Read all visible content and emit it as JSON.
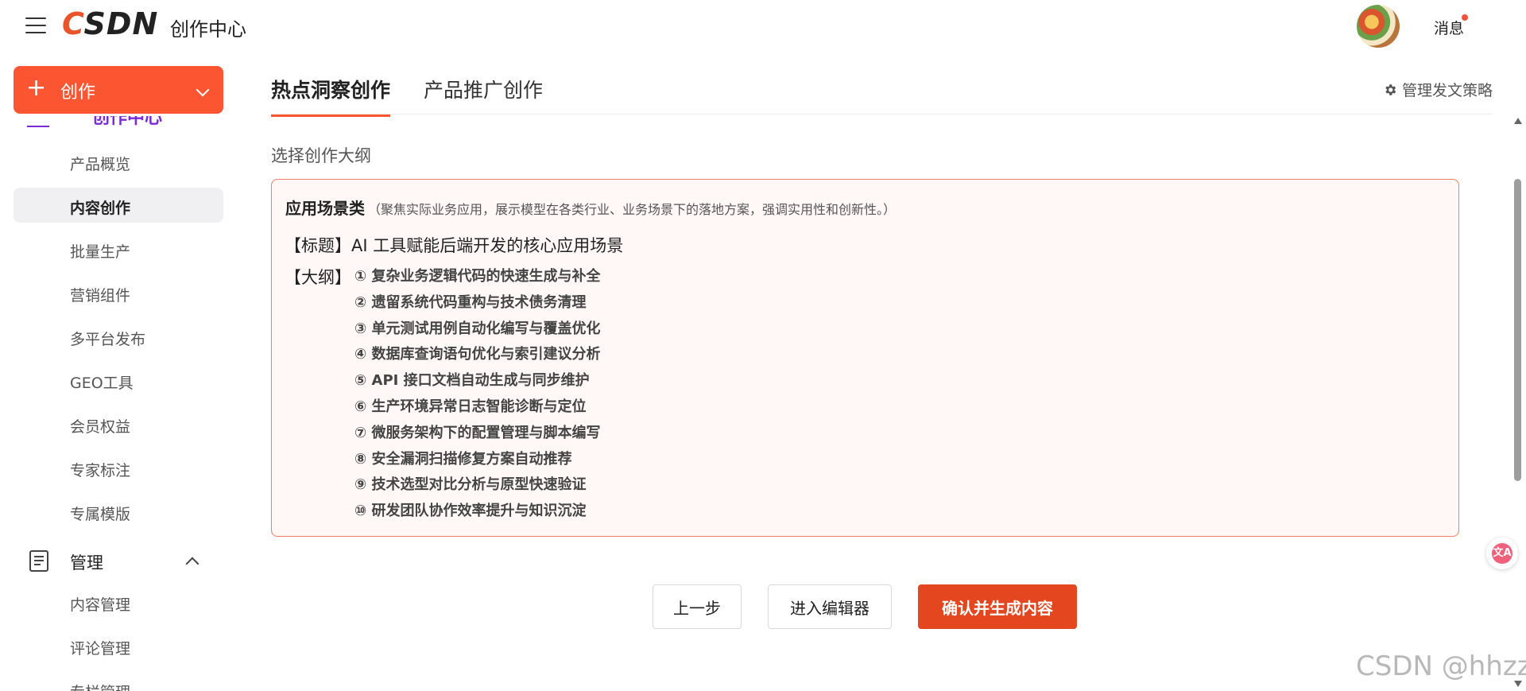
{
  "header": {
    "logo_prefix": "C",
    "logo_rest": "SDN",
    "title": "创作中心",
    "messages_label": "消息"
  },
  "sidebar": {
    "create_label": "创作",
    "partial_item_label": "创作中心",
    "items": [
      {
        "label": "产品概览",
        "active": false
      },
      {
        "label": "内容创作",
        "active": true
      },
      {
        "label": "批量生产",
        "active": false
      },
      {
        "label": "营销组件",
        "active": false
      },
      {
        "label": "多平台发布",
        "active": false
      },
      {
        "label": "GEO工具",
        "active": false
      },
      {
        "label": "会员权益",
        "active": false
      },
      {
        "label": "专家标注",
        "active": false
      },
      {
        "label": "专属模版",
        "active": false
      }
    ],
    "manage_group": {
      "label": "管理",
      "items": [
        "内容管理",
        "评论管理",
        "专栏管理"
      ]
    }
  },
  "tabs": [
    {
      "label": "热点洞察创作",
      "active": true
    },
    {
      "label": "产品推广创作",
      "active": false
    }
  ],
  "strategy_label": "管理发文策略",
  "section_label": "选择创作大纲",
  "card": {
    "category": "应用场景类",
    "description": "（聚焦实际业务应用，展示模型在各类行业、业务场景下的落地方案，强调实用性和创新性。）",
    "title_tag": "【标题】",
    "title": "AI 工具赋能后端开发的核心应用场景",
    "outline_tag": "【大纲】",
    "outline": [
      "① 复杂业务逻辑代码的快速生成与补全",
      "② 遗留系统代码重构与技术债务清理",
      "③ 单元测试用例自动化编写与覆盖优化",
      "④ 数据库查询语句优化与索引建议分析",
      "⑤ API 接口文档自动生成与同步维护",
      "⑥ 生产环境异常日志智能诊断与定位",
      "⑦ 微服务架构下的配置管理与脚本编写",
      "⑧ 安全漏洞扫描修复方案自动推荐",
      "⑨ 技术选型对比分析与原型快速验证",
      "⑩ 研发团队协作效率提升与知识沉淀"
    ]
  },
  "actions": {
    "prev": "上一步",
    "editor": "进入编辑器",
    "confirm": "确认并生成内容"
  },
  "translate_glyph": "文A",
  "watermark": "CSDN @hhzz",
  "colors": {
    "brand": "#fc5531",
    "confirm_button": "#e4461f",
    "card_border": "#f77d60",
    "card_bg": "#fff8f6"
  }
}
